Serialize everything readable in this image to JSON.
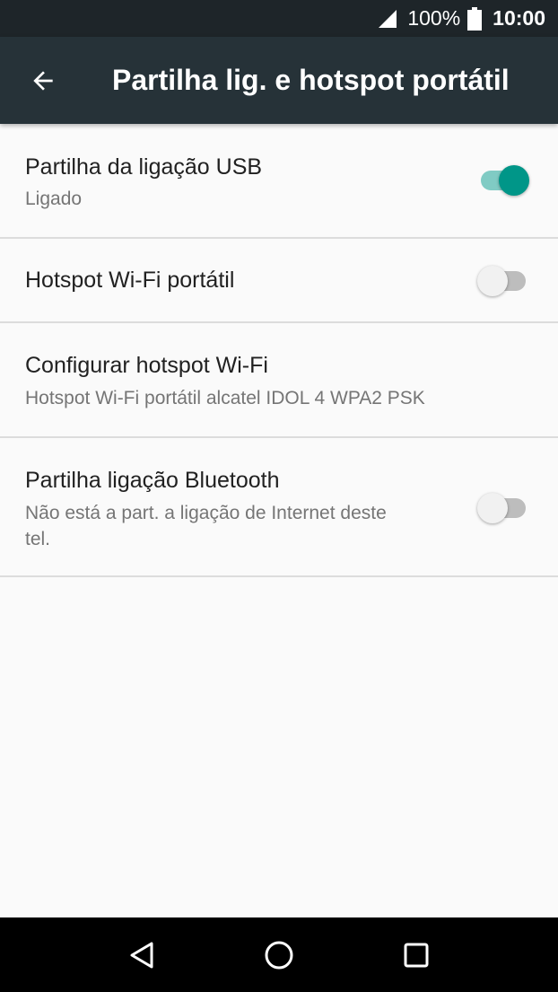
{
  "status_bar": {
    "battery_percent": "100%",
    "time": "10:00",
    "icons": [
      "signal-icon",
      "battery-icon"
    ]
  },
  "app_bar": {
    "title": "Partilha lig. e hotspot portátil",
    "back_icon": "arrow-back-icon"
  },
  "settings": [
    {
      "title": "Partilha da ligação USB",
      "summary": "Ligado",
      "toggle": true
    },
    {
      "title": "Hotspot Wi-Fi portátil",
      "toggle": false
    },
    {
      "title": "Configurar hotspot Wi-Fi",
      "summary": "Hotspot Wi-Fi portátil alcatel IDOL 4 WPA2 PSK"
    },
    {
      "title": "Partilha ligação Bluetooth",
      "summary": "Não está a part. a ligação de Internet deste tel.",
      "toggle": false
    }
  ],
  "nav_bar": {
    "icons": [
      "back-triangle-icon",
      "home-circle-icon",
      "recents-square-icon"
    ]
  },
  "colors": {
    "app_bar": "#263238",
    "status_bar": "#1e2529",
    "accent": "#009688",
    "accent_track": "#80cbc4",
    "background": "#fafafa"
  }
}
